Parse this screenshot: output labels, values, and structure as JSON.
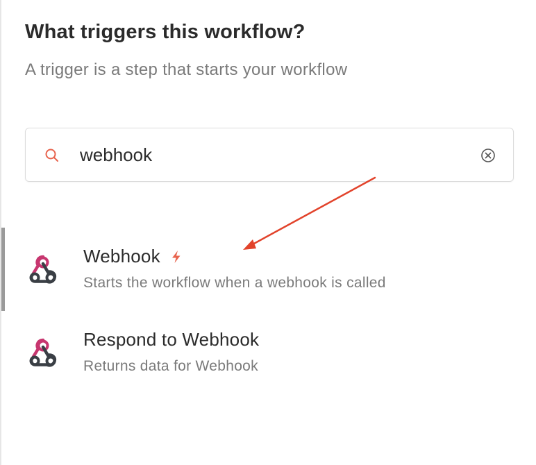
{
  "header": {
    "title": "What triggers this workflow?",
    "subtitle": "A trigger is a step that starts your workflow"
  },
  "search": {
    "value": "webhook",
    "icon": "search-icon",
    "clear_icon": "clear-icon"
  },
  "results": [
    {
      "name": "Webhook",
      "description": "Starts the workflow when a webhook is called",
      "icon": "webhook-icon",
      "badge_icon": "bolt-icon"
    },
    {
      "name": "Respond to Webhook",
      "description": "Returns data for Webhook",
      "icon": "webhook-icon"
    }
  ],
  "colors": {
    "accent": "#e8644e",
    "webhook_pink": "#c7366f",
    "webhook_dark": "#3a3f45",
    "annotation": "#e2432b"
  }
}
